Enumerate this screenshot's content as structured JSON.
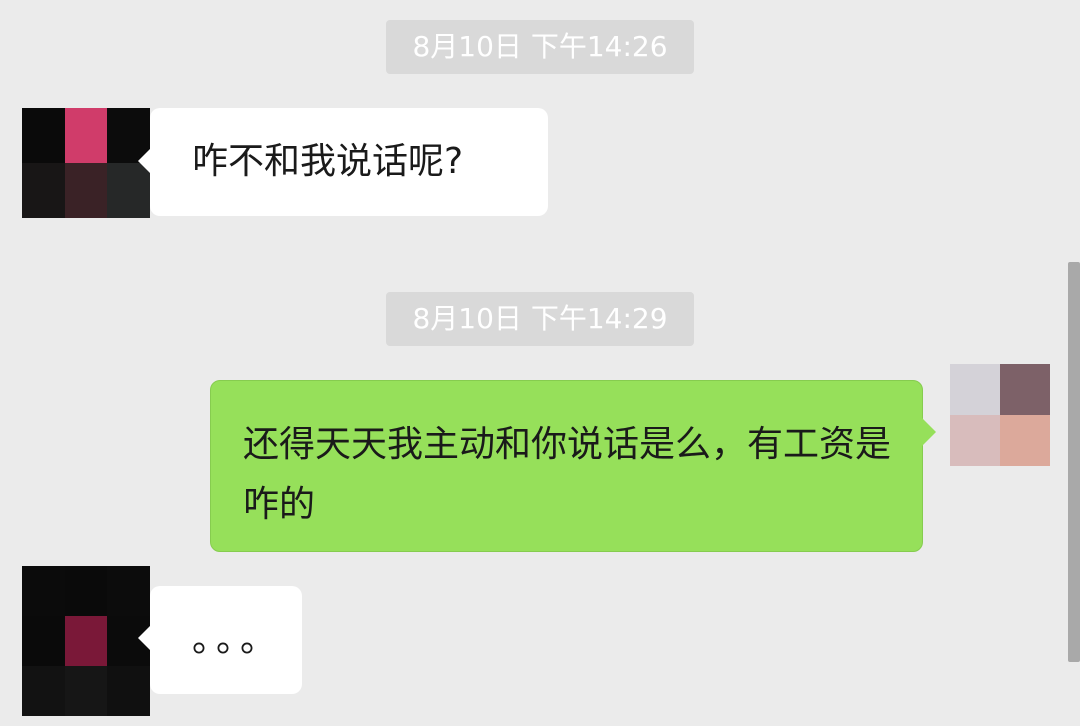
{
  "chat": {
    "messages": [
      {
        "type": "timestamp",
        "text": "8月10日 下午14:26"
      },
      {
        "type": "incoming",
        "text": "咋不和我说话呢?"
      },
      {
        "type": "timestamp",
        "text": "8月10日 下午14:29"
      },
      {
        "type": "outgoing",
        "text": "还得天天我主动和你说话是么，有工资是咋的"
      },
      {
        "type": "incoming",
        "text": "。。。"
      }
    ]
  },
  "colors": {
    "background": "#ebebeb",
    "timestamp_bg": "#d9d9d9",
    "incoming_bubble": "#ffffff",
    "outgoing_bubble": "#96e05a"
  },
  "avatars": {
    "contact_1": [
      "#0a0a0a",
      "#d03c6a",
      "#0c0c0c",
      "#181616",
      "#3a2226",
      "#262828"
    ],
    "contact_2": [
      "#0b0b0b",
      "#0a0a0a",
      "#0c0c0c",
      "#0a0a0a",
      "#7a1838",
      "#0b0b0b",
      "#121212",
      "#161616",
      "#101010"
    ],
    "self": [
      "#d4d2d8",
      "#7d6168",
      "#d8bcbc",
      "#dca99b"
    ]
  }
}
